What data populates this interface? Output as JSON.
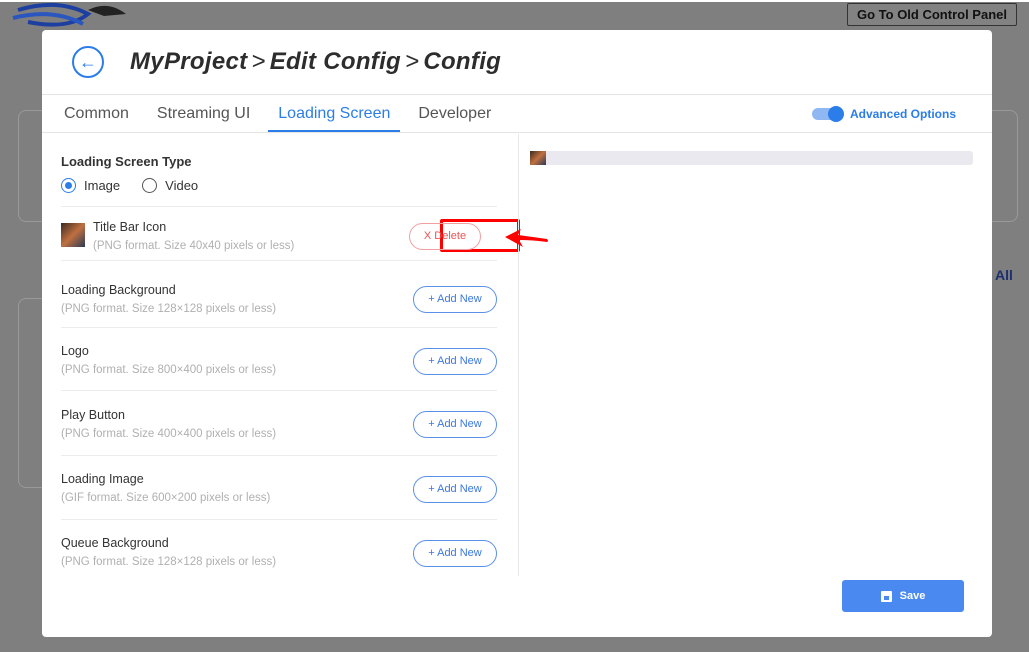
{
  "background": {
    "old_panel_button": "Go To Old Control Panel",
    "see_all": "All"
  },
  "header": {
    "crumbs": [
      "MyProject",
      "Edit Config",
      "Config"
    ],
    "separator": ">"
  },
  "tabs": [
    {
      "label": "Common"
    },
    {
      "label": "Streaming UI"
    },
    {
      "label": "Loading Screen",
      "active": true
    },
    {
      "label": "Developer"
    }
  ],
  "advanced": {
    "label": "Advanced Options",
    "enabled": true
  },
  "loading_type": {
    "label": "Loading Screen Type",
    "options": [
      "Image",
      "Video"
    ],
    "selected": "Image"
  },
  "rows": [
    {
      "title": "Title Bar Icon",
      "hint": "(PNG format. Size 40x40 pixels or less)",
      "button": "X Delete",
      "has_image": true
    },
    {
      "title": "Loading Background",
      "hint": "(PNG format. Size 128×128 pixels or less)",
      "button": "+ Add New"
    },
    {
      "title": "Logo",
      "hint": "(PNG format. Size 800×400 pixels or less)",
      "button": "+ Add New"
    },
    {
      "title": "Play Button",
      "hint": "(PNG format. Size 400×400 pixels or less)",
      "button": "+ Add New"
    },
    {
      "title": "Loading Image",
      "hint": "(GIF format. Size 600×200 pixels or less)",
      "button": "+ Add New"
    },
    {
      "title": "Queue Background",
      "hint": "(PNG format. Size 128×128 pixels or less)",
      "button": "+ Add New"
    }
  ],
  "save_label": "Save",
  "colors": {
    "accent": "#2b7de9",
    "delete": "#e85555",
    "highlight": "#ff0000"
  }
}
